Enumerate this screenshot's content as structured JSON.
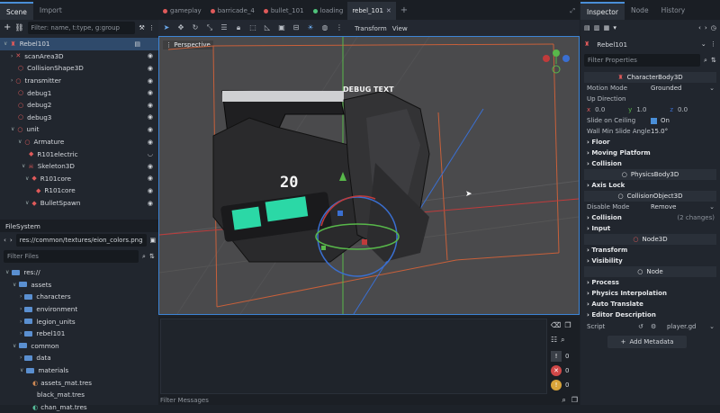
{
  "left_dock": {
    "tabs": [
      "Scene",
      "Import"
    ],
    "filter_placeholder": "Filter: name, t:type, g:group",
    "tree": [
      {
        "label": "Rebel101",
        "selected": true
      },
      {
        "label": "scanArea3D"
      },
      {
        "label": "CollisionShape3D"
      },
      {
        "label": "transmitter"
      },
      {
        "label": "debug1"
      },
      {
        "label": "debug2"
      },
      {
        "label": "debug3"
      },
      {
        "label": "unit"
      },
      {
        "label": "Armature"
      },
      {
        "label": "R101electric"
      },
      {
        "label": "Skeleton3D"
      },
      {
        "label": "R101core"
      },
      {
        "label": "R101core"
      },
      {
        "label": "BulletSpawn"
      }
    ],
    "filesystem_title": "FileSystem",
    "path": "res://common/textures/eion_colors.png",
    "filter_files_placeholder": "Filter Files",
    "files": [
      {
        "label": "res://",
        "type": "folder"
      },
      {
        "label": "assets",
        "type": "folder"
      },
      {
        "label": "characters",
        "type": "folder"
      },
      {
        "label": "environment",
        "type": "folder"
      },
      {
        "label": "legion_units",
        "type": "folder"
      },
      {
        "label": "rebel101",
        "type": "folder"
      },
      {
        "label": "common",
        "type": "folder"
      },
      {
        "label": "data",
        "type": "folder"
      },
      {
        "label": "materials",
        "type": "folder"
      },
      {
        "label": "assets_mat.tres",
        "type": "file"
      },
      {
        "label": "black_mat.tres",
        "type": "file"
      },
      {
        "label": "chan_mat.tres",
        "type": "file"
      }
    ]
  },
  "scene_tabs": [
    {
      "label": "gameplay",
      "color": "#e05a5a"
    },
    {
      "label": "barricade_4",
      "color": "#e05a5a"
    },
    {
      "label": "bullet_101",
      "color": "#e05a5a"
    },
    {
      "label": "loading",
      "color": "#4fc27a"
    },
    {
      "label": "rebel_101",
      "color": "#e05a5a",
      "active": true
    }
  ],
  "viewport_toolbar": {
    "transform": "Transform",
    "view": "View"
  },
  "viewport": {
    "perspective": "Perspective",
    "debug_text": "DEBUG TEXT",
    "number": "20"
  },
  "output": {
    "filter_placeholder": "Filter Messages",
    "counts": [
      "0",
      "0",
      "0"
    ]
  },
  "inspector": {
    "tabs": [
      "Inspector",
      "Node",
      "History"
    ],
    "node_name": "Rebel101",
    "filter_placeholder": "Filter Properties",
    "class_header": "CharacterBody3D",
    "motion_mode_label": "Motion Mode",
    "motion_mode_value": "Grounded",
    "up_direction_label": "Up Direction",
    "up_x": "0.0",
    "up_y": "1.0",
    "up_z": "0.0",
    "slide_label": "Slide on Ceiling",
    "slide_value": "On",
    "wall_label": "Wall Min Slide Angle",
    "wall_value": "15.0",
    "wall_unit": "°",
    "sections1": [
      "Floor",
      "Moving Platform",
      "Collision"
    ],
    "physics_header": "PhysicsBody3D",
    "axis_lock": "Axis Lock",
    "collision_obj_header": "CollisionObject3D",
    "disable_mode_label": "Disable Mode",
    "disable_mode_value": "Remove",
    "collision_label": "Collision",
    "collision_changes": "(2 changes)",
    "input_label": "Input",
    "node3d_header": "Node3D",
    "sections2": [
      "Transform",
      "Visibility"
    ],
    "node_header": "Node",
    "sections3": [
      "Process",
      "Physics Interpolation",
      "Auto Translate",
      "Editor Description"
    ],
    "script_label": "Script",
    "script_value": "player.gd",
    "add_metadata": "Add Metadata"
  },
  "colors": {
    "accent": "#4a8fd8",
    "node_red": "#e05a5a",
    "panel": "#21262e"
  }
}
